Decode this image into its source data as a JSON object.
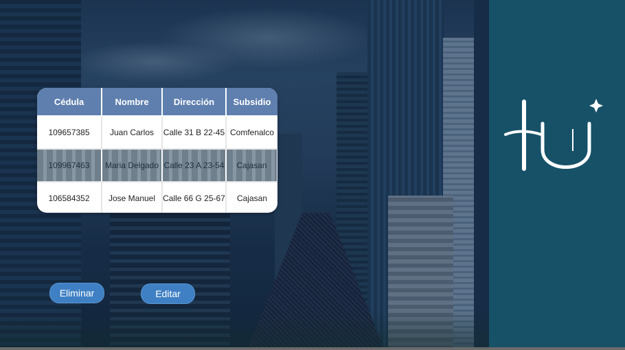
{
  "table": {
    "headers": [
      "Cédula",
      "Nombre",
      "Dirección",
      "Subsidio"
    ],
    "rows": [
      [
        "109657385",
        "Juan Carlos",
        "Calle 31 B 22-45",
        "Comfenalco"
      ],
      [
        "109967463",
        "Maria Delgado",
        "Calle 23 A 23-54",
        "Cajasan"
      ],
      [
        "106584352",
        "Jose Manuel",
        "Calle 66 G 25-67",
        "Cajasan"
      ]
    ],
    "selected_row": 1
  },
  "buttons": {
    "delete_label": "Eliminar",
    "edit_label": "Editar"
  },
  "colors": {
    "panel": "#175168",
    "table_header": "#5f7fae",
    "button": "#3f80c4"
  },
  "logo": {
    "text": "IU",
    "icon": "sparkle-star-icon"
  }
}
